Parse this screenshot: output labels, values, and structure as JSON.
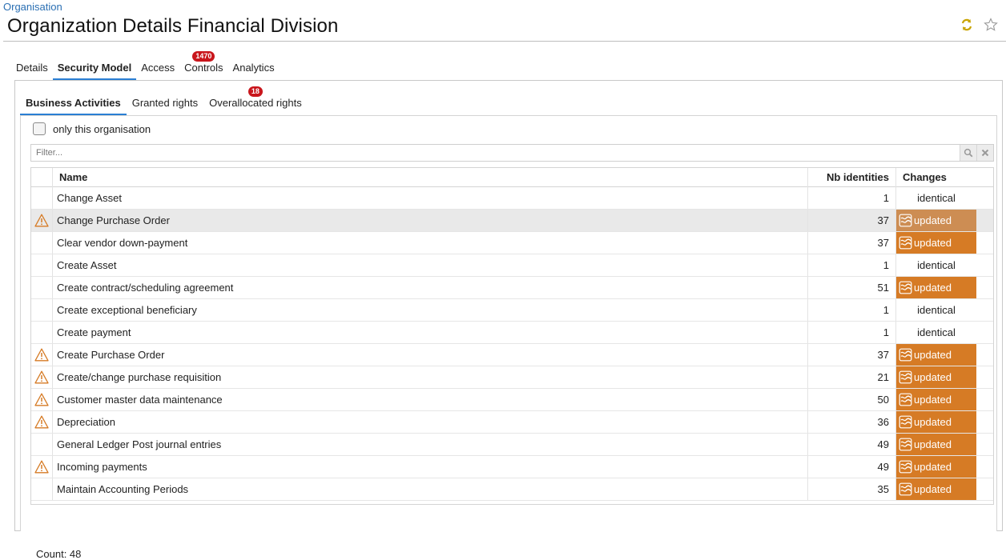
{
  "breadcrumb": "Organisation",
  "title": "Organization Details Financial Division",
  "main_tabs": [
    {
      "label": "Details",
      "badge": null,
      "active": false
    },
    {
      "label": "Security Model",
      "badge": null,
      "active": true
    },
    {
      "label": "Access",
      "badge": null,
      "active": false
    },
    {
      "label": "Controls",
      "badge": "1470",
      "active": false
    },
    {
      "label": "Analytics",
      "badge": null,
      "active": false
    }
  ],
  "sub_tabs": [
    {
      "label": "Business Activities",
      "badge": null,
      "active": true
    },
    {
      "label": "Granted rights",
      "badge": null,
      "active": false
    },
    {
      "label": "Overallocated rights",
      "badge": "18",
      "active": false
    }
  ],
  "only_org_label": "only this organisation",
  "filter": {
    "placeholder": "Filter...",
    "value": ""
  },
  "columns": {
    "name": "Name",
    "nb": "Nb identities",
    "changes": "Changes"
  },
  "rows": [
    {
      "warning": false,
      "name": "Change Asset",
      "nb": "1",
      "changes": "identical",
      "selected": false
    },
    {
      "warning": true,
      "name": "Change Purchase Order",
      "nb": "37",
      "changes": "updated",
      "selected": true
    },
    {
      "warning": false,
      "name": "Clear vendor down-payment",
      "nb": "37",
      "changes": "updated",
      "selected": false
    },
    {
      "warning": false,
      "name": "Create Asset",
      "nb": "1",
      "changes": "identical",
      "selected": false
    },
    {
      "warning": false,
      "name": "Create contract/scheduling agreement",
      "nb": "51",
      "changes": "updated",
      "selected": false
    },
    {
      "warning": false,
      "name": "Create exceptional beneficiary",
      "nb": "1",
      "changes": "identical",
      "selected": false
    },
    {
      "warning": false,
      "name": "Create payment",
      "nb": "1",
      "changes": "identical",
      "selected": false
    },
    {
      "warning": true,
      "name": "Create Purchase Order",
      "nb": "37",
      "changes": "updated",
      "selected": false
    },
    {
      "warning": true,
      "name": "Create/change purchase requisition",
      "nb": "21",
      "changes": "updated",
      "selected": false
    },
    {
      "warning": true,
      "name": "Customer master data maintenance",
      "nb": "50",
      "changes": "updated",
      "selected": false
    },
    {
      "warning": true,
      "name": "Depreciation",
      "nb": "36",
      "changes": "updated",
      "selected": false
    },
    {
      "warning": false,
      "name": "General Ledger Post journal entries",
      "nb": "49",
      "changes": "updated",
      "selected": false
    },
    {
      "warning": true,
      "name": "Incoming payments",
      "nb": "49",
      "changes": "updated",
      "selected": false
    },
    {
      "warning": false,
      "name": "Maintain Accounting Periods",
      "nb": "35",
      "changes": "updated",
      "selected": false
    }
  ],
  "count_label": "Count: 48",
  "colors": {
    "accent": "#2a7fd4",
    "updated": "#d67b25",
    "badge": "#c9161c",
    "link": "#2a6fb3"
  },
  "icons": {
    "header": [
      "sync-icon",
      "star-icon"
    ],
    "row_warning": "warning-icon",
    "row_change": "changes-icon",
    "filter": [
      "search-icon",
      "clear-icon"
    ]
  }
}
